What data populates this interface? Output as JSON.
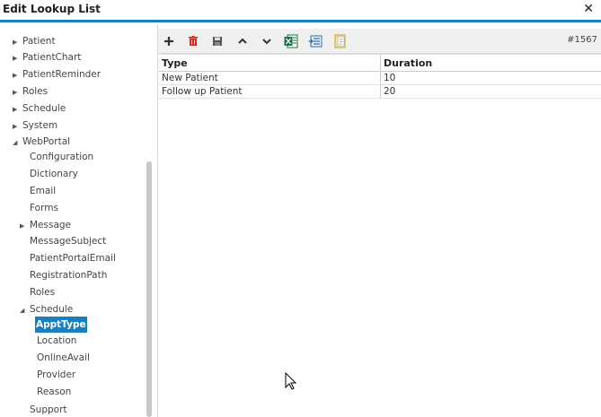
{
  "window": {
    "title": "Edit Lookup List",
    "close_glyph": "✕"
  },
  "tree": {
    "items": [
      {
        "label": "Patient",
        "arrow": "▶"
      },
      {
        "label": "PatientChart",
        "arrow": "▶"
      },
      {
        "label": "PatientReminder",
        "arrow": "▶"
      },
      {
        "label": "Roles",
        "arrow": "▶"
      },
      {
        "label": "Schedule",
        "arrow": "▶"
      },
      {
        "label": "System",
        "arrow": "▶"
      },
      {
        "label": "WebPortal",
        "arrow": "◢"
      },
      {
        "label": "Configuration",
        "arrow": ""
      },
      {
        "label": "Dictionary",
        "arrow": ""
      },
      {
        "label": "Email",
        "arrow": ""
      },
      {
        "label": "Forms",
        "arrow": ""
      },
      {
        "label": "Message",
        "arrow": "▶"
      },
      {
        "label": "MessageSubject",
        "arrow": ""
      },
      {
        "label": "PatientPortalEmail",
        "arrow": ""
      },
      {
        "label": "RegistrationPath",
        "arrow": ""
      },
      {
        "label": "Roles",
        "arrow": ""
      },
      {
        "label": "Schedule",
        "arrow": "◢"
      },
      {
        "label": "ApptType",
        "arrow": ""
      },
      {
        "label": "Location",
        "arrow": ""
      },
      {
        "label": "OnlineAvail",
        "arrow": ""
      },
      {
        "label": "Provider",
        "arrow": ""
      },
      {
        "label": "Reason",
        "arrow": ""
      },
      {
        "label": "Support",
        "arrow": ""
      }
    ]
  },
  "toolbar": {
    "record_count": "#1567",
    "colors": {
      "add": "#333333",
      "delete": "#d9261c",
      "save": "#555555",
      "excel": "#1e7145",
      "export": "#2b6cb0",
      "notes": "#c9a227"
    }
  },
  "grid": {
    "columns": [
      "Type",
      "Duration"
    ],
    "rows": [
      [
        "New Patient",
        "10"
      ],
      [
        "Follow up Patient",
        "20"
      ]
    ]
  }
}
